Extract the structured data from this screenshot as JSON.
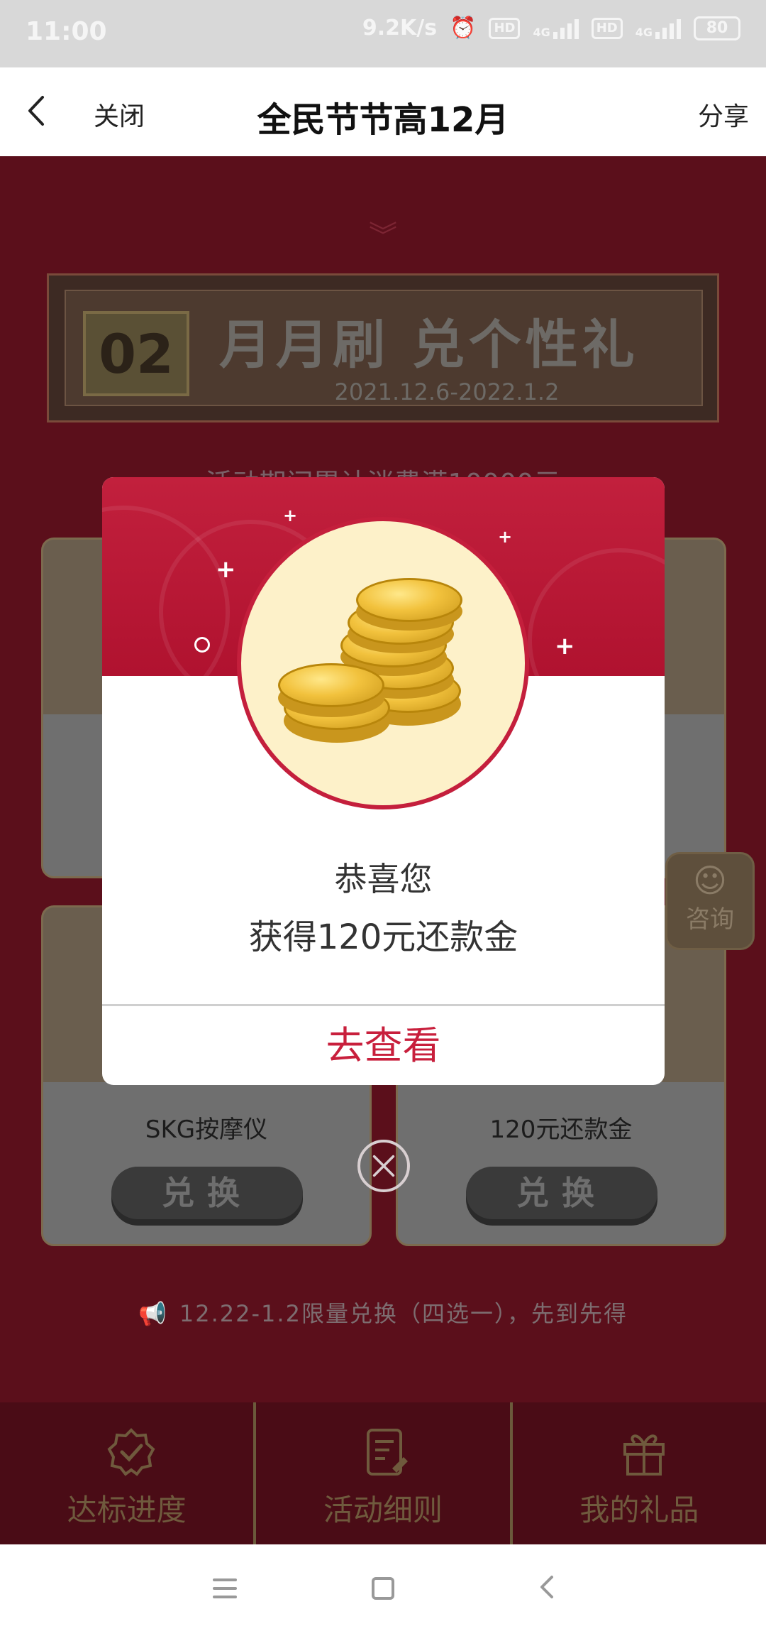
{
  "status_bar": {
    "time": "11:00",
    "speed": "9.2K/s",
    "hd1": "HD",
    "hd2": "HD",
    "net1": "4G",
    "net2": "4G",
    "battery": "80"
  },
  "header": {
    "close": "关闭",
    "title": "全民节节高12月",
    "share": "分享"
  },
  "background": {
    "banner_number": "02",
    "banner_title": "月月刷 兑个性礼",
    "banner_date": "2021.12.6-2022.1.2",
    "description": "活动期间累计消费满10000元",
    "cards": [
      {
        "label": "SKG按摩仪",
        "button": "兑换"
      },
      {
        "label": "120元还款金",
        "button": "兑换"
      }
    ],
    "notice": "12.22-1.2限量兑换（四选一），先到先得",
    "consult": "咨询"
  },
  "tabbar": [
    {
      "label": "达标进度",
      "icon": "badge-check-icon"
    },
    {
      "label": "活动细则",
      "icon": "document-icon"
    },
    {
      "label": "我的礼品",
      "icon": "gift-icon"
    }
  ],
  "modal": {
    "congrats": "恭喜您",
    "prize": "获得120元还款金",
    "button": "去查看"
  },
  "colors": {
    "accent": "#c81f3c",
    "header_red": "#b0122f",
    "coin_bg": "#fdf1c9"
  }
}
